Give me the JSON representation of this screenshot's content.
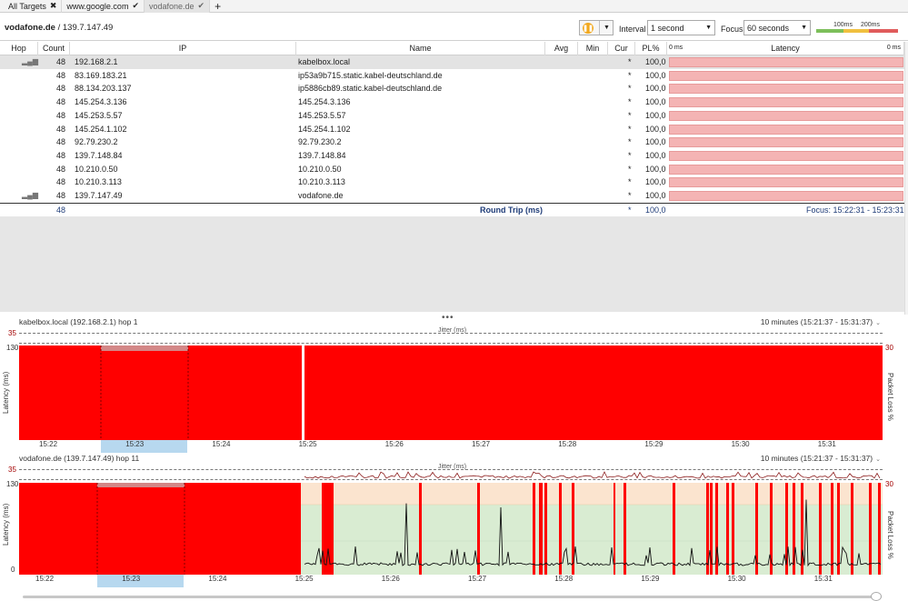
{
  "tabs": [
    {
      "label": "All Targets",
      "icon": "close-icon"
    },
    {
      "label": "www.google.com",
      "icon": "check-icon"
    },
    {
      "label": "vodafone.de",
      "icon": "check-icon"
    }
  ],
  "header": {
    "target_name": "vodafone.de",
    "target_ip": " / 139.7.147.49",
    "interval_label": "Interval",
    "interval_value": "1 second",
    "focus_label": "Focus",
    "focus_value": "60 seconds",
    "legend": {
      "l100": "100ms",
      "l200": "200ms"
    },
    "colors": {
      "good": "#7dbf5b",
      "warn": "#f0c040",
      "bad": "#e05c5c",
      "pause": "#f2a81d"
    }
  },
  "table": {
    "columns": [
      "Hop",
      "Count",
      "IP",
      "Name",
      "Avg",
      "Min",
      "Cur",
      "PL%",
      "Latency"
    ],
    "latency_axis": {
      "left": "0 ms",
      "right": "0 ms"
    },
    "rows": [
      {
        "count": "48",
        "ip": "192.168.2.1",
        "name": "kabelbox.local",
        "cur": "*",
        "pl": "100,0"
      },
      {
        "count": "48",
        "ip": "83.169.183.21",
        "name": "ip53a9b715.static.kabel-deutschland.de",
        "cur": "*",
        "pl": "100,0"
      },
      {
        "count": "48",
        "ip": "88.134.203.137",
        "name": "ip5886cb89.static.kabel-deutschland.de",
        "cur": "*",
        "pl": "100,0"
      },
      {
        "count": "48",
        "ip": "145.254.3.136",
        "name": "145.254.3.136",
        "cur": "*",
        "pl": "100,0"
      },
      {
        "count": "48",
        "ip": "145.253.5.57",
        "name": "145.253.5.57",
        "cur": "*",
        "pl": "100,0"
      },
      {
        "count": "48",
        "ip": "145.254.1.102",
        "name": "145.254.1.102",
        "cur": "*",
        "pl": "100,0"
      },
      {
        "count": "48",
        "ip": "92.79.230.2",
        "name": "92.79.230.2",
        "cur": "*",
        "pl": "100,0"
      },
      {
        "count": "48",
        "ip": "139.7.148.84",
        "name": "139.7.148.84",
        "cur": "*",
        "pl": "100,0"
      },
      {
        "count": "48",
        "ip": "10.210.0.50",
        "name": "10.210.0.50",
        "cur": "*",
        "pl": "100,0"
      },
      {
        "count": "48",
        "ip": "10.210.3.113",
        "name": "10.210.3.113",
        "cur": "*",
        "pl": "100,0"
      },
      {
        "count": "48",
        "ip": "139.7.147.49",
        "name": "vodafone.de",
        "cur": "*",
        "pl": "100,0"
      }
    ],
    "round_trip": {
      "count": "48",
      "label": "Round Trip (ms)",
      "cur": "*",
      "pl": "100,0",
      "focus": "Focus: 15:22:31 - 15:23:31"
    }
  },
  "graphs": [
    {
      "title": "kabelbox.local (192.168.2.1) hop 1",
      "range": "10 minutes (15:21:37 - 15:31:37)",
      "jitter_label": "Jitter (ms)",
      "jitter_max": "35",
      "y_max": "130",
      "y_label": "Latency (ms)",
      "loss_max": "30",
      "loss_label": "Packet Loss %",
      "ticks": [
        "15:22",
        "15:23",
        "15:24",
        "15:25",
        "15:26",
        "15:27",
        "15:28",
        "15:29",
        "15:30",
        "15:31"
      ]
    },
    {
      "title": "vodafone.de (139.7.147.49) hop 11",
      "range": "10 minutes (15:21:37 - 15:31:37)",
      "jitter_label": "Jitter (ms)",
      "jitter_max": "35",
      "y_max": "130",
      "y_min": "0",
      "y_label": "Latency (ms)",
      "loss_max": "30",
      "loss_label": "Packet Loss %",
      "ticks": [
        "15:22",
        "15:23",
        "15:24",
        "15:25",
        "15:26",
        "15:27",
        "15:28",
        "15:29",
        "15:30",
        "15:31"
      ]
    }
  ]
}
